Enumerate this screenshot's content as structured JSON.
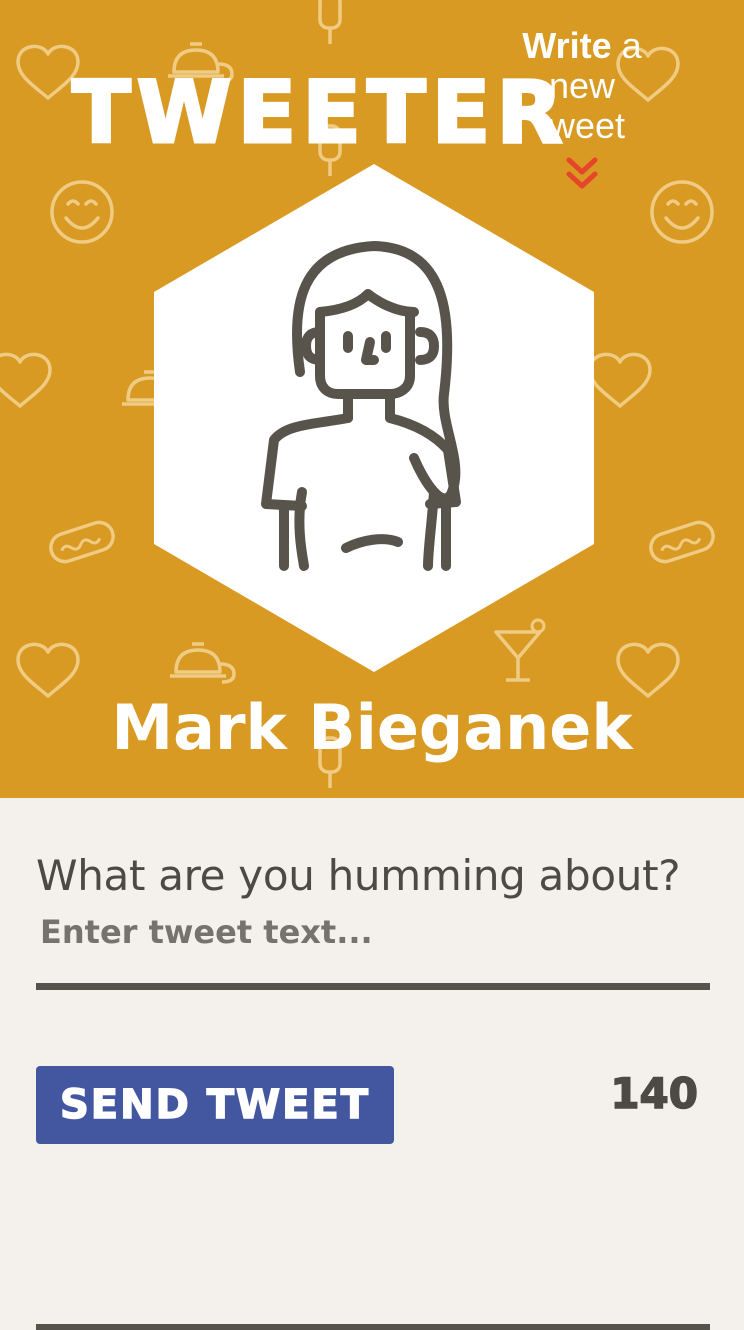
{
  "header": {
    "brand": "TWEETER",
    "write_toggle": {
      "strong": "Write",
      "rest_line1": "a",
      "line2": "new",
      "line3": "tweet",
      "chevron_icon": "double-chevron-down-icon"
    },
    "profile": {
      "avatar_icon": "woman-avatar-icon",
      "name": "Mark Bieganek"
    }
  },
  "compose": {
    "label": "What are you humming about?",
    "placeholder": "Enter tweet text...",
    "value": "",
    "send_label": "Send Tweet",
    "counter": "140"
  },
  "colors": {
    "header_bg": "#d89a22",
    "page_bg": "#f4f1ec",
    "button_bg": "#4357a1",
    "chevron": "#e6452a",
    "text_dark": "#4d4a44"
  }
}
